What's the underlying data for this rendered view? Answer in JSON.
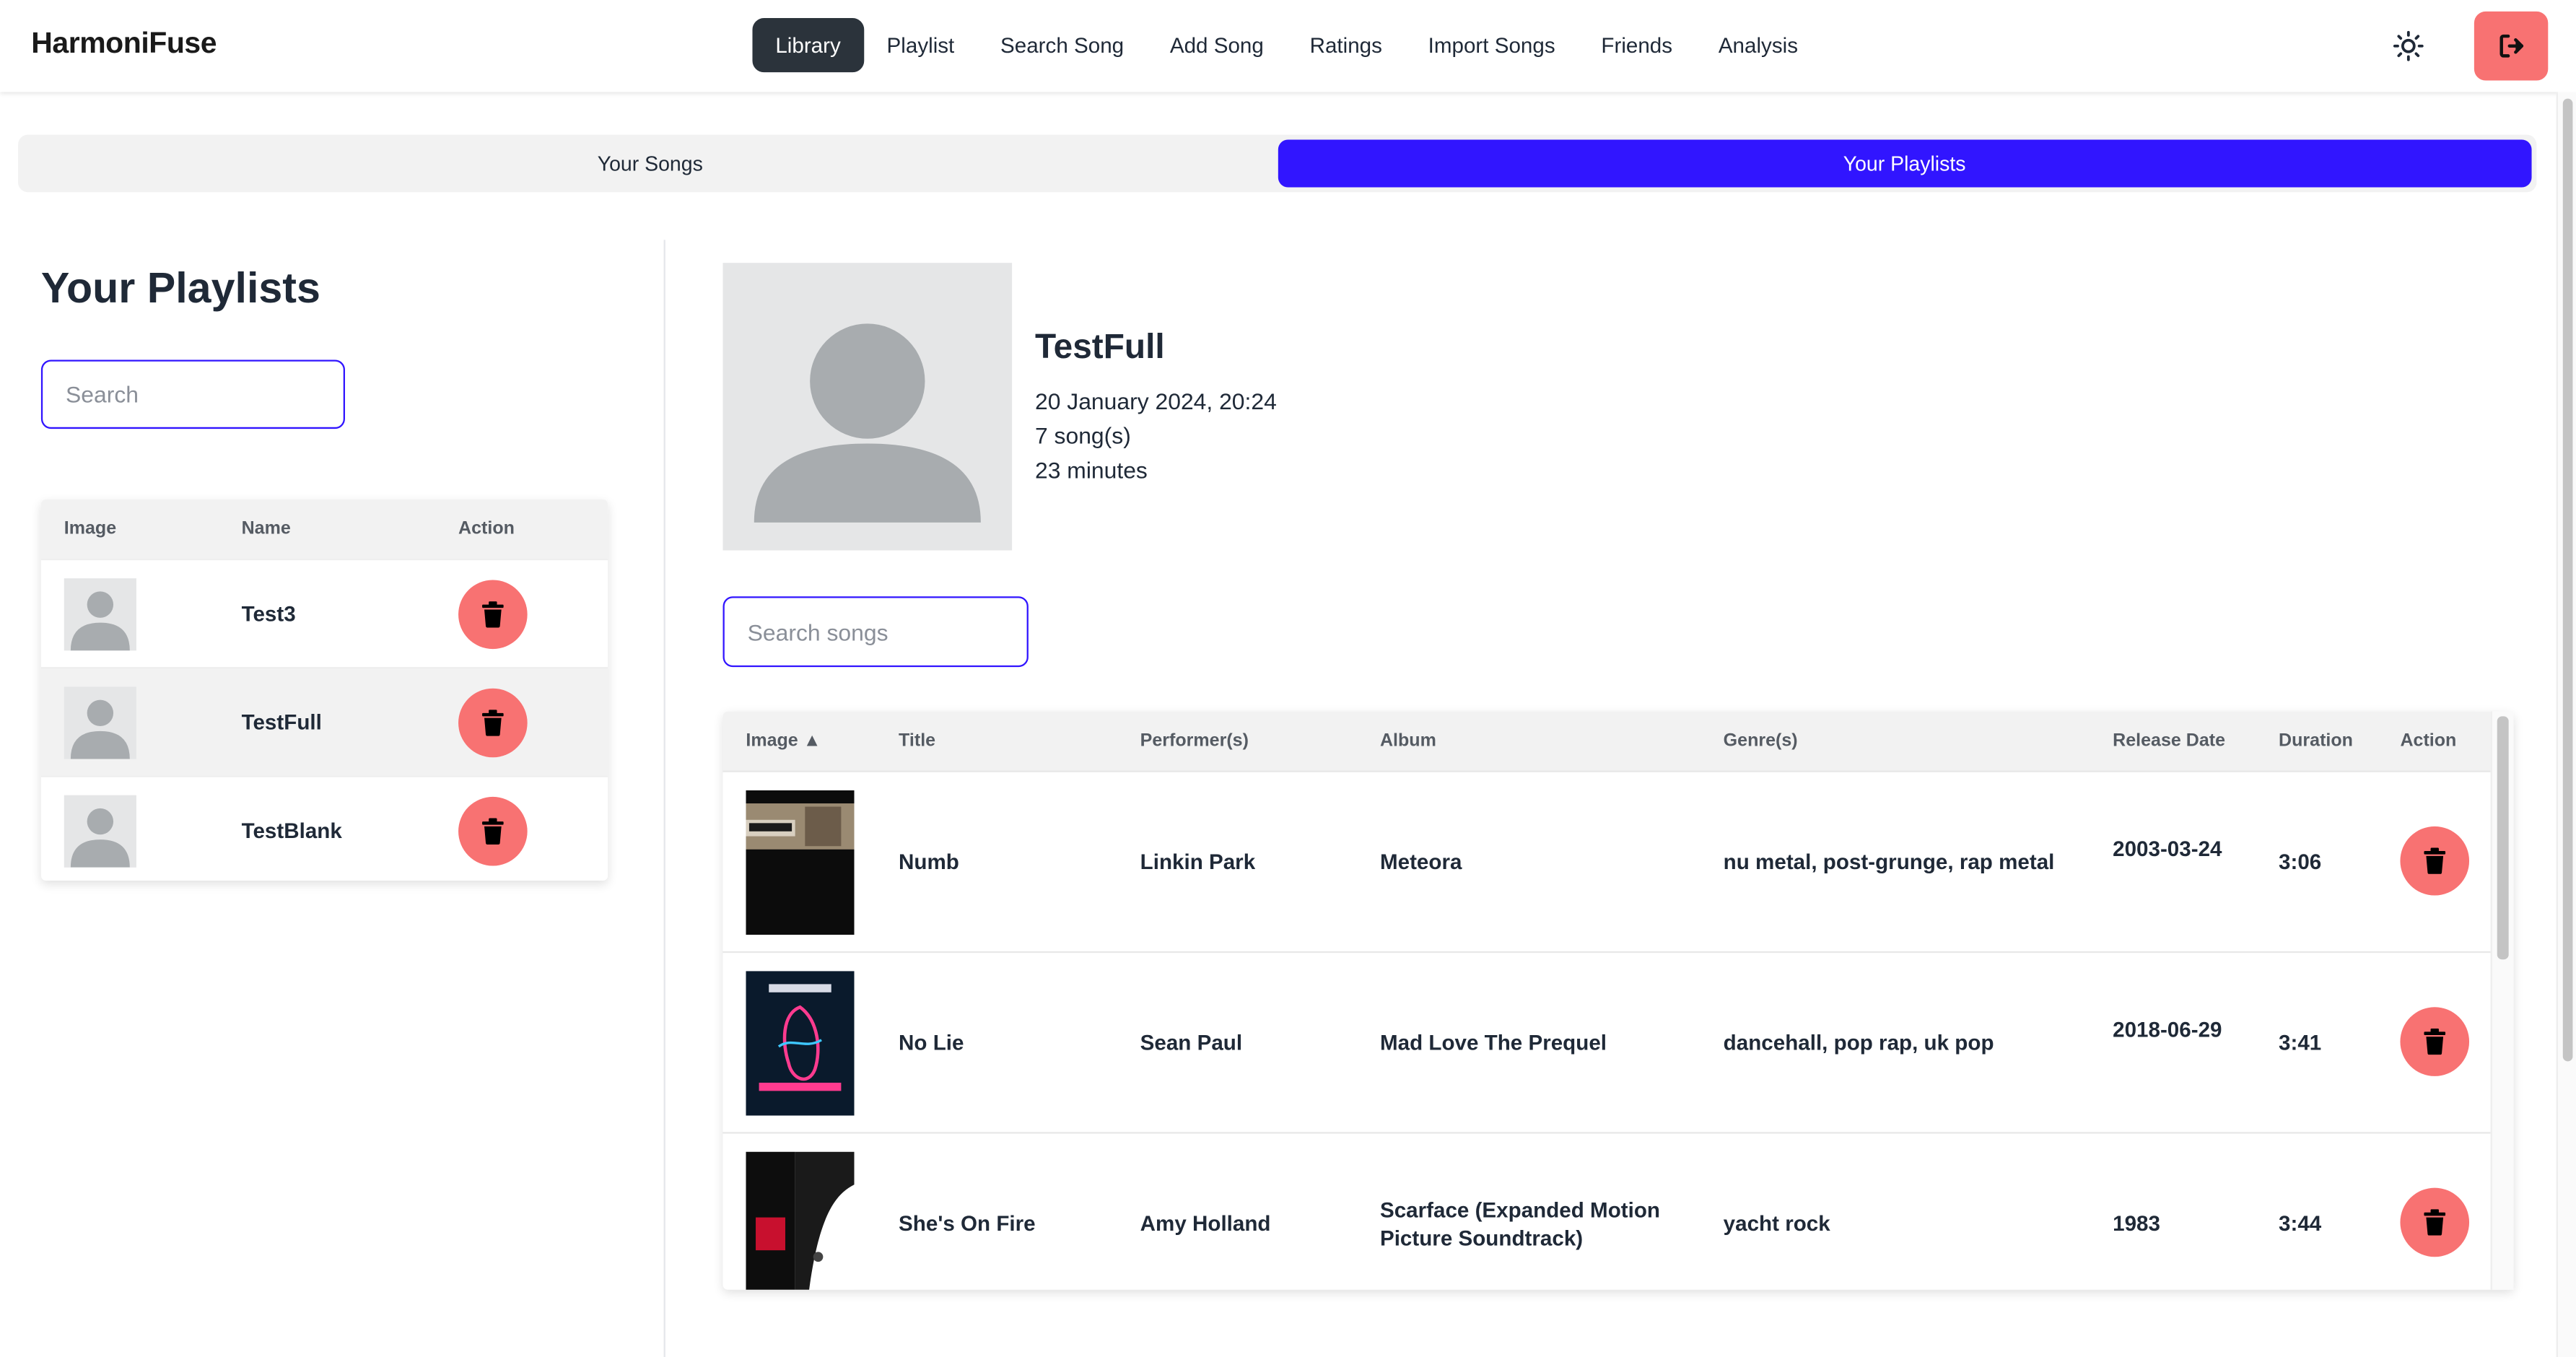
{
  "app": {
    "brand": "HarmoniFuse"
  },
  "nav": {
    "items": [
      {
        "label": "Library",
        "active": true
      },
      {
        "label": "Playlist",
        "active": false
      },
      {
        "label": "Search Song",
        "active": false
      },
      {
        "label": "Add Song",
        "active": false
      },
      {
        "label": "Ratings",
        "active": false
      },
      {
        "label": "Import Songs",
        "active": false
      },
      {
        "label": "Friends",
        "active": false
      },
      {
        "label": "Analysis",
        "active": false
      }
    ],
    "theme_icon": "sun-icon",
    "logout_icon": "logout-icon"
  },
  "tabs": [
    {
      "label": "Your Songs",
      "active": false
    },
    {
      "label": "Your Playlists",
      "active": true
    }
  ],
  "playlists_panel": {
    "title": "Your Playlists",
    "search_placeholder": "Search",
    "columns": [
      "Image",
      "Name",
      "Action"
    ],
    "rows": [
      {
        "name": "Test3"
      },
      {
        "name": "TestFull"
      },
      {
        "name": "TestBlank"
      }
    ]
  },
  "playlist_detail": {
    "name": "TestFull",
    "created": "20 January 2024, 20:24",
    "song_count": "7 song(s)",
    "duration": "23 minutes",
    "search_placeholder": "Search songs",
    "columns": [
      "Image ▲",
      "Title",
      "Performer(s)",
      "Album",
      "Genre(s)",
      "Release Date",
      "Duration",
      "Action"
    ],
    "songs": [
      {
        "title": "Numb",
        "performer": "Linkin Park",
        "album": "Meteora",
        "genres": "nu metal, post-grunge, rap metal",
        "release_date": "2003-03-24",
        "duration": "3:06"
      },
      {
        "title": "No Lie",
        "performer": "Sean Paul",
        "album": "Mad Love The Prequel",
        "genres": "dancehall, pop rap, uk pop",
        "release_date": "2018-06-29",
        "duration": "3:41"
      },
      {
        "title": "She's On Fire",
        "performer": "Amy Holland",
        "album": "Scarface (Expanded Motion Picture Soundtrack)",
        "genres": "yacht rock",
        "release_date": "1983",
        "duration": "3:44"
      }
    ]
  },
  "colors": {
    "accent": "#3115ff",
    "danger": "#f87272",
    "nav_active": "#2b333b"
  }
}
